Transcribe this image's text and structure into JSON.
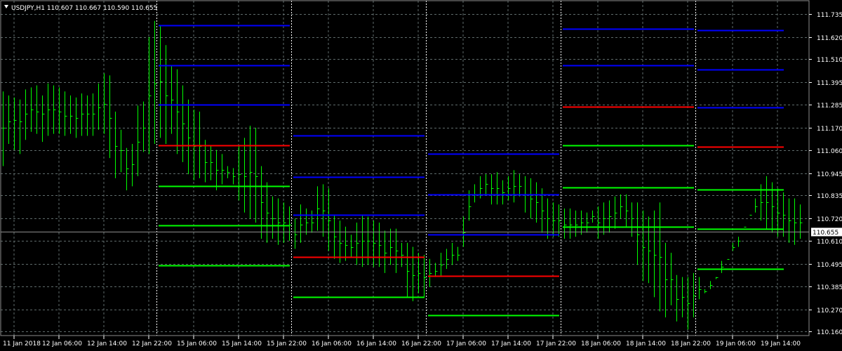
{
  "header": {
    "symbol_line": "USDJPY,H1  110.607 110.667 110.590 110.655"
  },
  "colors": {
    "background": "#000000",
    "grid": "#5f6b6b",
    "bars": "#00ff00",
    "pivot": "#ff0000",
    "resistance": "#0000ff",
    "support": "#00ff00",
    "current_price_line": "#8c8c8c",
    "axis_text": "#ffffff"
  },
  "chart_data": {
    "type": "line",
    "title": "USDJPY,H1  110.607 110.667 110.590 110.655",
    "instrument": "USDJPY",
    "timeframe": "H1",
    "ohlc_header": {
      "open": 110.607,
      "high": 110.667,
      "low": 110.59,
      "close": 110.655
    },
    "current_price": 110.655,
    "current_price_label": "110.655",
    "ylim": [
      110.14,
      111.8
    ],
    "y_ticks": [
      "111.735",
      "111.620",
      "111.510",
      "111.395",
      "111.285",
      "111.170",
      "111.060",
      "110.945",
      "110.835",
      "110.720",
      "110.610",
      "110.495",
      "110.385",
      "110.270",
      "110.160"
    ],
    "x_ticks": [
      "11 Jan 2018",
      "12 Jan 06:00",
      "12 Jan 14:00",
      "12 Jan 22:00",
      "15 Jan 06:00",
      "15 Jan 14:00",
      "15 Jan 22:00",
      "16 Jan 06:00",
      "16 Jan 14:00",
      "16 Jan 22:00",
      "17 Jan 06:00",
      "17 Jan 14:00",
      "17 Jan 22:00",
      "18 Jan 06:00",
      "18 Jan 14:00",
      "18 Jan 22:00",
      "19 Jan 06:00",
      "19 Jan 14:00"
    ],
    "period_separators_after_tick": [
      "12 Jan 22:00",
      "15 Jan 22:00",
      "16 Jan 22:00",
      "17 Jan 22:00",
      "18 Jan 22:00"
    ],
    "grid": true,
    "bars_hourly": {
      "start_tick": "11 Jan 2018",
      "hours_per_tick": 8,
      "high": [
        111.35,
        111.33,
        111.32,
        111.31,
        111.36,
        111.37,
        111.38,
        111.33,
        111.39,
        111.38,
        111.37,
        111.35,
        111.33,
        111.32,
        111.34,
        111.33,
        111.34,
        111.39,
        111.44,
        111.43,
        111.25,
        111.16,
        111.07,
        111.09,
        111.28,
        111.3,
        111.62,
        111.7,
        111.68,
        111.58,
        111.48,
        111.46,
        111.38,
        111.31,
        111.26,
        111.25,
        111.11,
        111.08,
        111.06,
        111.04,
        110.98,
        110.97,
        111.08,
        111.12,
        111.18,
        111.17,
        110.98,
        110.9,
        110.83,
        110.82,
        110.8,
        110.78,
        110.72,
        110.79,
        110.77,
        110.76,
        110.88,
        110.89,
        110.87,
        110.74,
        110.71,
        110.68,
        110.64,
        110.7,
        110.74,
        110.73,
        110.71,
        110.7,
        110.66,
        110.67,
        110.67,
        110.6,
        110.6,
        110.58,
        110.55,
        110.54,
        110.52,
        110.5,
        110.55,
        110.57,
        110.6,
        110.58,
        110.73,
        110.86,
        110.89,
        110.93,
        110.94,
        110.94,
        110.95,
        110.91,
        110.93,
        110.96,
        110.94,
        110.93,
        110.92,
        110.9,
        110.87,
        110.82,
        110.8,
        110.79,
        110.77,
        110.77,
        110.76,
        110.76,
        110.75,
        110.76,
        110.78,
        110.8,
        110.81,
        110.83,
        110.84,
        110.84,
        110.8,
        110.8,
        110.76,
        110.73,
        110.76,
        110.8,
        110.6,
        110.55,
        110.44,
        110.43,
        110.43,
        110.45,
        110.43,
        110.37,
        110.41,
        110.43,
        110.45,
        110.52,
        110.6,
        110.63,
        110.68,
        110.74,
        110.82,
        110.89,
        110.93,
        110.9,
        110.87,
        110.85,
        110.82,
        110.82,
        110.79,
        110.77,
        110.76,
        110.74,
        110.72,
        110.72,
        110.78,
        110.78,
        110.82,
        110.82,
        110.83,
        110.8,
        110.78,
        110.78,
        110.8,
        110.82,
        110.83,
        110.8,
        110.86,
        111.01,
        111.08,
        111.09,
        111.22,
        111.34,
        111.38,
        111.4,
        111.35,
        111.36,
        111.38,
        111.44,
        111.42,
        111.43,
        111.47,
        111.46,
        111.42,
        111.37,
        111.35,
        111.35,
        111.33,
        111.31,
        111.35,
        111.31,
        111.32,
        111.34,
        111.36,
        111.33,
        111.31,
        111.28,
        111.24,
        111.24,
        111.17,
        111.13,
        111.17,
        111.13,
        111.03,
        111.04,
        111.02,
        111.02,
        110.96,
        111.0,
        111.2,
        111.14,
        111.09,
        111.06,
        111.04,
        111.09,
        111.1,
        111.12,
        111.1,
        111.08,
        111.09,
        111.06,
        111.04,
        110.98,
        110.97,
        110.92,
        110.9,
        110.92,
        110.92,
        110.9,
        110.86,
        110.83,
        110.8,
        110.78,
        110.77,
        110.78,
        110.77,
        110.72,
        110.74,
        110.74,
        110.71,
        110.67,
        110.71,
        110.7,
        110.68
      ],
      "low": [
        110.98,
        111.09,
        111.06,
        111.04,
        111.11,
        111.15,
        111.14,
        111.1,
        111.13,
        111.14,
        111.14,
        111.13,
        111.14,
        111.12,
        111.13,
        111.13,
        111.13,
        111.16,
        111.14,
        111.02,
        110.92,
        110.95,
        110.86,
        110.88,
        110.93,
        111.05,
        111.04,
        111.09,
        111.12,
        111.09,
        111.14,
        111.04,
        111.0,
        110.94,
        110.91,
        110.92,
        110.9,
        110.91,
        110.86,
        110.89,
        110.92,
        110.89,
        110.81,
        110.75,
        110.72,
        110.7,
        110.62,
        110.6,
        110.62,
        110.59,
        110.6,
        110.61,
        110.57,
        110.6,
        110.64,
        110.65,
        110.66,
        110.63,
        110.56,
        110.52,
        110.5,
        110.51,
        110.53,
        110.49,
        110.48,
        110.49,
        110.48,
        110.48,
        110.45,
        110.49,
        110.45,
        110.48,
        110.33,
        110.31,
        110.35,
        110.33,
        110.38,
        110.43,
        110.43,
        110.47,
        110.49,
        110.51,
        110.58,
        110.71,
        110.8,
        110.82,
        110.84,
        110.79,
        110.79,
        110.79,
        110.81,
        110.8,
        110.83,
        110.75,
        110.72,
        110.7,
        110.65,
        110.62,
        110.63,
        110.63,
        110.62,
        110.62,
        110.63,
        110.64,
        110.65,
        110.7,
        110.62,
        110.64,
        110.65,
        110.67,
        110.72,
        110.68,
        110.63,
        110.49,
        110.41,
        110.4,
        110.33,
        110.26,
        110.23,
        110.29,
        110.21,
        110.23,
        110.17,
        110.23,
        110.32,
        110.35,
        110.37,
        110.42,
        110.51,
        110.52,
        110.56,
        110.58,
        110.68,
        110.74,
        110.75,
        110.71,
        110.67,
        110.65,
        110.63,
        110.63,
        110.6,
        110.59,
        110.62,
        110.61,
        110.57,
        110.6,
        110.61,
        110.62,
        110.61,
        110.62,
        110.64,
        110.61,
        110.6,
        110.63,
        110.62,
        110.62,
        110.62,
        110.6,
        110.65,
        110.62,
        110.72,
        110.9,
        110.99,
        111.03,
        111.1,
        111.09,
        111.2,
        111.2,
        111.18,
        111.16,
        111.15,
        111.16,
        111.13,
        111.14,
        111.16,
        111.09,
        111.07,
        111.07,
        111.09,
        111.09,
        111.03,
        111.04,
        111.08,
        111.09,
        111.07,
        111.03,
        111.01,
        111.01,
        111.02,
        110.9,
        110.88,
        110.86,
        110.82,
        110.82,
        110.71,
        110.69,
        110.77,
        110.89,
        110.9,
        110.89,
        110.91,
        110.89,
        110.93,
        110.92,
        110.83,
        110.88,
        110.87,
        110.78,
        110.8,
        110.72,
        110.72,
        110.72,
        110.7,
        110.62,
        110.58,
        110.54,
        110.5,
        110.49,
        110.51,
        110.55,
        110.53,
        110.52,
        110.55,
        110.54,
        110.52,
        110.51,
        110.52,
        110.56,
        110.59,
        110.59
      ],
      "close": [
        111.17,
        111.2,
        111.21,
        111.2,
        111.24,
        111.26,
        111.25,
        111.24,
        111.26,
        111.26,
        111.25,
        111.23,
        111.23,
        111.22,
        111.24,
        111.24,
        111.24,
        111.27,
        111.29,
        111.22,
        111.08,
        111.06,
        110.97,
        110.99,
        111.1,
        111.17,
        111.33,
        111.39,
        111.4,
        111.33,
        111.31,
        111.25,
        111.19,
        111.12,
        111.08,
        111.08,
        111.0,
        111.0,
        110.96,
        110.96,
        110.95,
        110.93,
        110.94,
        110.93,
        110.95,
        110.93,
        110.8,
        110.75,
        110.72,
        110.7,
        110.7,
        110.69,
        110.64,
        110.69,
        110.7,
        110.7,
        110.77,
        110.76,
        110.71,
        110.63,
        110.6,
        110.59,
        110.58,
        110.6,
        110.61,
        110.61,
        110.6,
        110.59,
        110.55,
        110.58,
        110.56,
        110.54,
        110.46,
        110.44,
        110.45,
        110.43,
        110.45,
        110.46,
        110.49,
        110.52,
        110.54,
        110.54,
        110.65,
        110.78,
        110.84,
        110.87,
        110.89,
        110.87,
        110.87,
        110.85,
        110.87,
        110.88,
        110.88,
        110.84,
        110.82,
        110.8,
        110.76,
        110.72,
        110.71,
        110.71,
        110.69,
        110.69,
        110.69,
        110.7,
        110.7,
        110.73,
        110.7,
        110.72,
        110.73,
        110.75,
        110.78,
        110.76,
        110.72,
        110.64,
        110.58,
        110.56,
        110.54,
        110.53,
        110.42,
        110.42,
        110.32,
        110.33,
        110.3,
        110.34,
        110.37,
        110.36,
        110.39,
        110.43,
        110.48,
        110.52,
        110.58,
        110.61,
        110.68,
        110.74,
        110.78,
        110.8,
        110.8,
        110.78,
        110.75,
        110.74,
        110.71,
        110.7,
        110.7,
        110.68,
        110.67,
        110.66,
        110.66,
        110.66,
        110.7,
        110.7,
        110.72,
        110.71,
        110.72,
        110.7,
        110.69,
        110.7,
        110.71,
        110.71,
        110.72,
        110.7,
        110.75,
        110.82,
        110.9,
        110.99,
        111.05,
        111.16,
        111.22,
        111.29,
        111.27,
        111.26,
        111.26,
        111.3,
        111.27,
        111.28,
        111.32,
        111.28,
        111.25,
        111.22,
        111.22,
        111.22,
        111.21,
        111.2,
        111.19,
        111.2,
        111.2,
        111.21,
        111.22,
        111.18,
        111.16,
        111.14,
        111.13,
        111.07,
        111.03,
        110.99,
        110.99,
        110.97,
        110.87,
        110.86,
        110.9,
        110.98,
        111.05,
        111.02,
        111.0,
        110.97,
        110.98,
        111.0,
        110.97,
        110.98,
        110.98,
        110.92,
        110.92,
        110.85,
        110.81,
        110.82,
        110.81,
        110.76,
        110.72,
        110.69,
        110.64,
        110.63,
        110.64,
        110.66,
        110.65,
        110.64,
        110.65,
        110.64,
        110.61,
        110.59,
        110.61,
        110.63,
        110.64,
        110.655
      ]
    },
    "levels": [
      {
        "start_tick": "12 Jan 22:00",
        "end_tick": "15 Jan 22:00",
        "pivot": 111.083,
        "r1": 111.285,
        "r2": 111.479,
        "r3": 111.677,
        "s1": 110.88,
        "s2": 110.686,
        "s3": 110.488
      },
      {
        "start_tick": "15 Jan 22:00",
        "end_tick": "16 Jan 22:00",
        "pivot": 110.53,
        "r1": 110.737,
        "r2": 110.927,
        "r3": 111.132,
        "s1": 110.333
      },
      {
        "start_tick": "16 Jan 22:00",
        "end_tick": "17 Jan 22:00",
        "pivot": 110.435,
        "r1": 110.64,
        "r2": 110.84,
        "r3": 111.042,
        "s1": 110.241
      },
      {
        "start_tick": "17 Jan 22:00",
        "end_tick": "18 Jan 22:00",
        "pivot": 111.273,
        "r1": 111.479,
        "r2": 111.661,
        "s1": 111.083,
        "s2": 110.873,
        "s3": 110.68
      },
      {
        "start_tick": "18 Jan 22:00",
        "end_tick": "19 Jan 14:00",
        "pivot": 111.077,
        "r1": 111.271,
        "r2": 111.458,
        "r3": 111.655,
        "s1": 110.865,
        "s2": 110.668,
        "s3": 110.472
      }
    ]
  }
}
